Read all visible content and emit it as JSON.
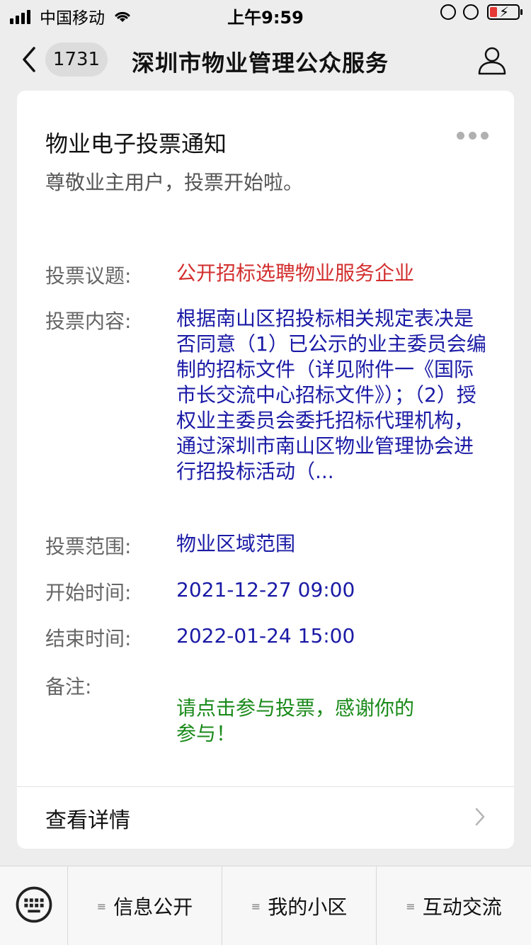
{
  "status_bar": {
    "carrier": "中国移动",
    "time": "上午9:59"
  },
  "nav": {
    "badge_count": "1731",
    "title": "深圳市物业管理公众服务"
  },
  "card": {
    "title": "物业电子投票通知",
    "subtitle": "尊敬业主用户，投票开始啦。",
    "fields": [
      {
        "label": "投票议题:",
        "value": "公开招标选聘物业服务企业",
        "color": "#d32f2f"
      },
      {
        "label": "投票内容:",
        "value": "根据南山区招投标相关规定表决是否同意（1）已公示的业主委员会编制的招标文件（详见附件一《国际市长交流中心招标文件》）；（2）授权业主委员会委托招标代理机构，通过深圳市南山区物业管理协会进行招投标活动（...",
        "color": "#1a1aa6"
      },
      {
        "label": "投票范围:",
        "value": "物业区域范围",
        "color": "#1a1aa6"
      },
      {
        "label": "开始时间:",
        "value": "2021-12-27 09:00",
        "color": "#1a1aa6"
      },
      {
        "label": "结束时间:",
        "value": "2022-01-24 15:00",
        "color": "#1a1aa6"
      },
      {
        "label": "备注:",
        "value": "请点击参与投票，感谢你的参与！",
        "color": "#1a8a1a"
      }
    ],
    "detail_link": "查看详情"
  },
  "bottom_menu": {
    "items": [
      {
        "label": "信息公开"
      },
      {
        "label": "我的小区"
      },
      {
        "label": "互动交流"
      }
    ]
  },
  "icons": {
    "back": "chevron-left-icon",
    "profile": "person-icon",
    "more": "ellipsis-icon",
    "keyboard": "keyboard-icon",
    "menu": "menu-lines-icon"
  }
}
